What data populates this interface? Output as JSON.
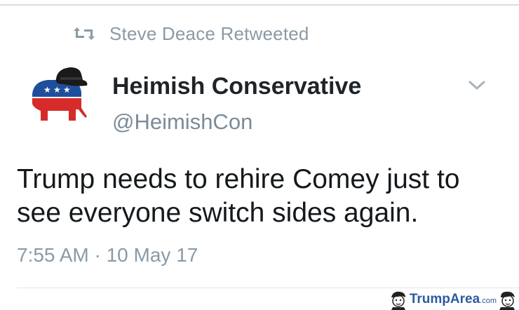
{
  "retweet": {
    "icon": "retweet-icon",
    "text": "Steve Deace Retweeted"
  },
  "author": {
    "avatar_icon": "republican-elephant-with-hat-icon",
    "display_name": "Heimish Conservative",
    "handle": "@HeimishCon"
  },
  "tweet": {
    "text": "Trump needs to rehire Comey just to see everyone switch sides again.",
    "timestamp": "7:55 AM · 10 May 17"
  },
  "menu": {
    "icon": "chevron-down-icon"
  },
  "watermark": {
    "brand_part1": "Trump",
    "brand_part2": "Area",
    "brand_suffix": ".com"
  },
  "colors": {
    "secondary_text": "#8a9aa6",
    "primary_text": "#15191c",
    "elephant_red": "#d62b2b",
    "elephant_blue": "#1f4f9c"
  }
}
